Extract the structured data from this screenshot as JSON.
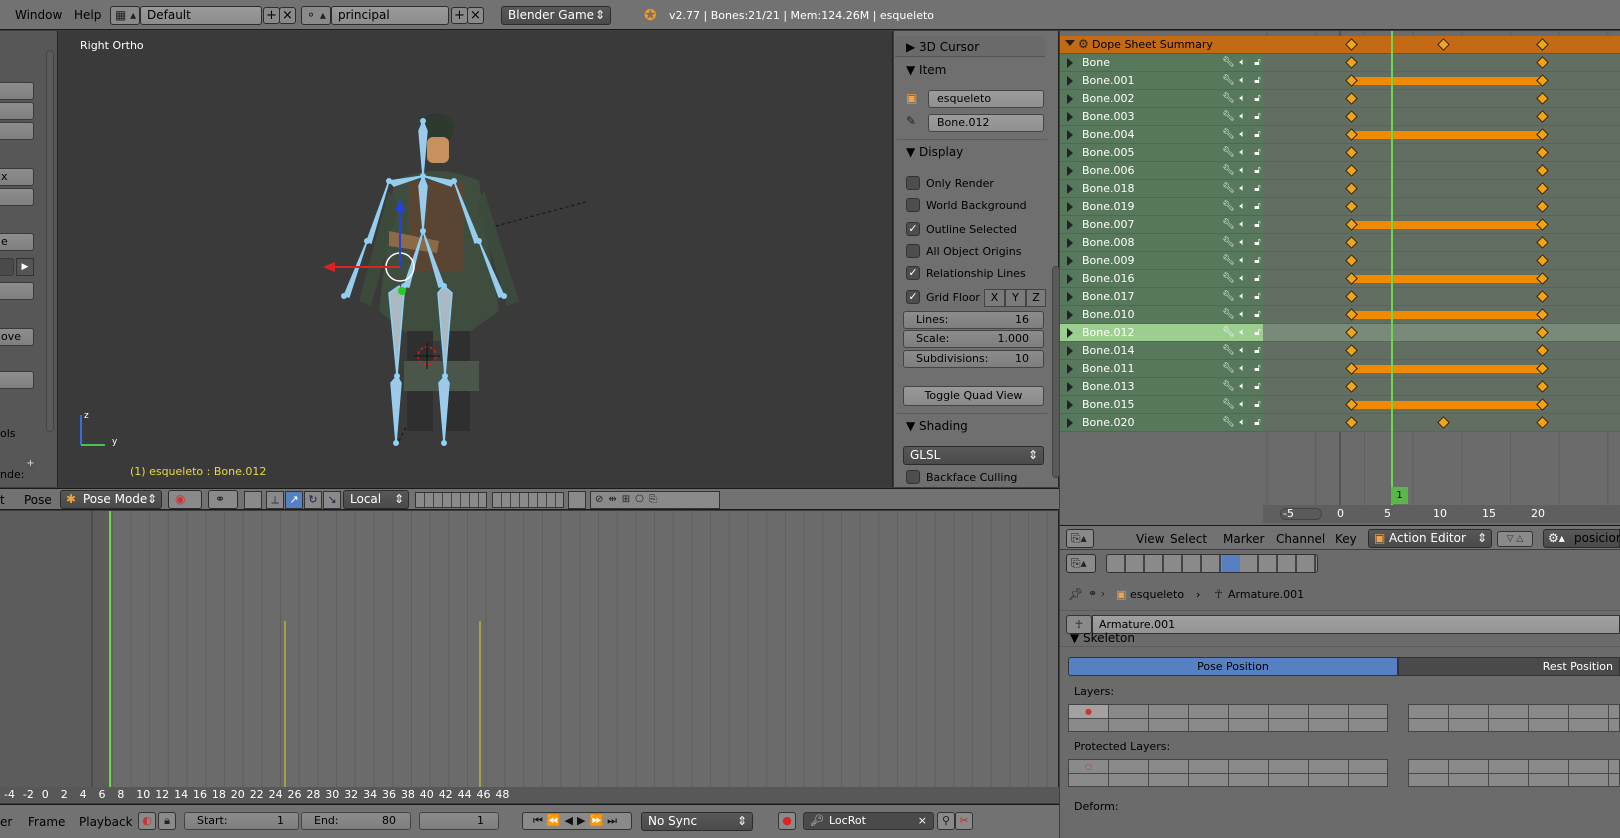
{
  "topbar": {
    "menus": [
      "Window",
      "Help"
    ],
    "layout": "Default",
    "scene": "principal",
    "engine": "Blender Game",
    "info": "v2.77 | Bones:21/21 | Mem:124.26M | esqueleto"
  },
  "toolshelf": {
    "buttons": [
      "",
      "",
      "",
      "x",
      "",
      "e",
      "",
      "",
      "ove",
      "",
      "ols",
      "nde:"
    ]
  },
  "viewport": {
    "view_label": "Right Ortho",
    "status": "(1) esqueleto : Bone.012",
    "axis_z": "z",
    "axis_y": "y"
  },
  "npanel": {
    "sections": {
      "cursor": "3D Cursor",
      "item": "Item",
      "display": "Display",
      "shading": "Shading"
    },
    "object_name": "esqueleto",
    "bone_name": "Bone.012",
    "checks": [
      {
        "label": "Only Render",
        "checked": false
      },
      {
        "label": "World Background",
        "checked": false
      },
      {
        "label": "Outline Selected",
        "checked": true
      },
      {
        "label": "All Object Origins",
        "checked": false
      },
      {
        "label": "Relationship Lines",
        "checked": true
      },
      {
        "label": "Grid Floor",
        "checked": true
      }
    ],
    "grid_axes": [
      "X",
      "Y",
      "Z"
    ],
    "lines_label": "Lines:",
    "lines_value": "16",
    "scale_label": "Scale:",
    "scale_value": "1.000",
    "subdiv_label": "Subdivisions:",
    "subdiv_value": "10",
    "toggle_quad": "Toggle Quad View",
    "shading_mode": "GLSL",
    "backface": "Backface Culling"
  },
  "vp_header": {
    "menu_t": "t",
    "pose_menu": "Pose",
    "mode": "Pose Mode",
    "orientation": "Local"
  },
  "timeline": {
    "ruler": [
      "-4",
      "-2",
      "0",
      "2",
      "4",
      "6",
      "8",
      "10",
      "12",
      "14",
      "16",
      "18",
      "20",
      "22",
      "24",
      "26",
      "28",
      "30",
      "32",
      "34",
      "36",
      "38",
      "40",
      "42",
      "44",
      "46",
      "48"
    ],
    "menus": [
      "er",
      "Frame",
      "Playback"
    ],
    "start_label": "Start:",
    "start_value": "1",
    "end_label": "End:",
    "end_value": "80",
    "current": "1",
    "sync": "No Sync",
    "keying_set": "LocRot"
  },
  "dopesheet": {
    "summary": "Dope Sheet Summary",
    "channels": [
      "Bone",
      "Bone.001",
      "Bone.002",
      "Bone.003",
      "Bone.004",
      "Bone.005",
      "Bone.006",
      "Bone.018",
      "Bone.019",
      "Bone.007",
      "Bone.008",
      "Bone.009",
      "Bone.016",
      "Bone.017",
      "Bone.010",
      "Bone.012",
      "Bone.014",
      "Bone.011",
      "Bone.013",
      "Bone.015",
      "Bone.020"
    ],
    "selected_channel": "Bone.012",
    "ruler": [
      "-5",
      "0",
      "5",
      "10",
      "15",
      "20"
    ],
    "current_frame": "1",
    "menus": [
      "View",
      "Select",
      "Marker",
      "Channel",
      "Key"
    ],
    "mode": "Action Editor",
    "action": "posicion"
  },
  "properties": {
    "object": "esqueleto",
    "armature": "Armature.001",
    "datablock": "Armature.001",
    "skeleton": "Skeleton",
    "pose_position": "Pose Position",
    "rest_position": "Rest Position",
    "layers": "Layers:",
    "protected_layers": "Protected Layers:",
    "deform": "Deform:"
  },
  "colors": {
    "accent_blue": "#5680c2",
    "keyframe_orange": "#f08a00",
    "summary_orange": "#c46a14",
    "selected_channel": "#9ccf8f",
    "playhead_green": "#6bd84a"
  }
}
